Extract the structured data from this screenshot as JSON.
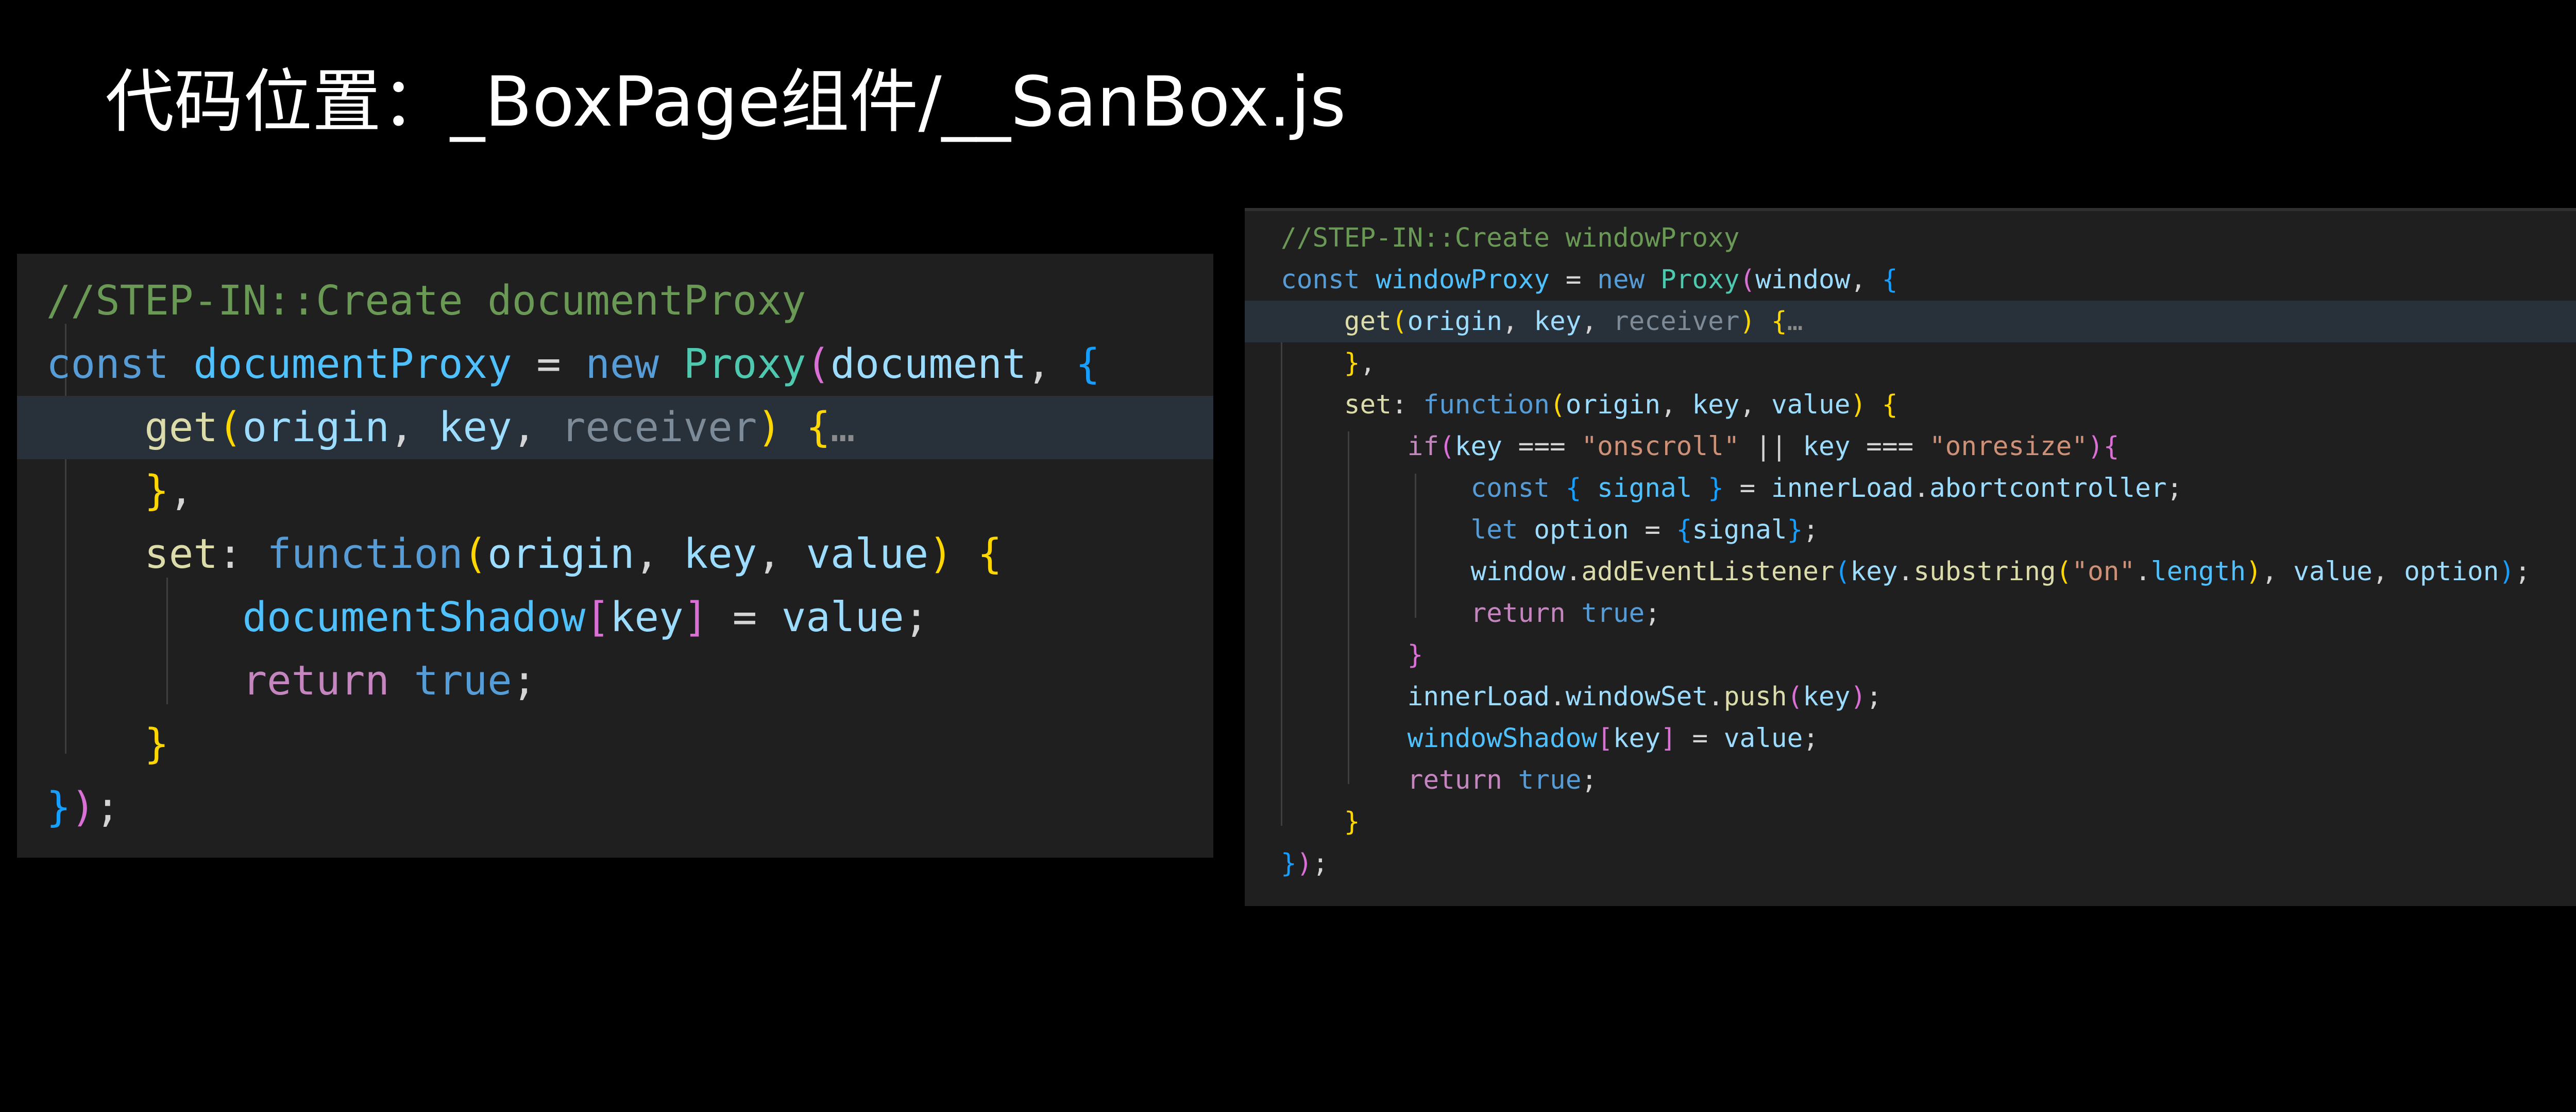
{
  "slide": {
    "title": "代码位置：_BoxPage组件/__SanBox.js"
  },
  "colors": {
    "background": "#000000",
    "editor_bg": "#1f1f1f",
    "highlight_line": "#283039",
    "comment": "#6a9955",
    "keyword": "#569cd6",
    "control": "#c586c0",
    "variable": "#9cdcfe",
    "class": "#4ec9b0",
    "function": "#dcdcaa",
    "string": "#ce9178",
    "bracket_gold": "#ffd700",
    "bracket_pink": "#da70d6",
    "bracket_blue": "#179fff"
  },
  "document_proxy_code": {
    "lines": [
      [
        {
          "t": "//STEP-IN::Create documentProxy",
          "c": "comment"
        }
      ],
      [
        {
          "t": "const ",
          "c": "kw"
        },
        {
          "t": "documentProxy",
          "c": "const"
        },
        {
          "t": " = ",
          "c": "punc"
        },
        {
          "t": "new ",
          "c": "kw"
        },
        {
          "t": "Proxy",
          "c": "class"
        },
        {
          "t": "(",
          "c": "b2"
        },
        {
          "t": "document",
          "c": "var"
        },
        {
          "t": ", ",
          "c": "punc"
        },
        {
          "t": "{",
          "c": "b3"
        }
      ],
      [
        {
          "t": "    ",
          "c": "punc"
        },
        {
          "t": "get",
          "c": "fn"
        },
        {
          "t": "(",
          "c": "b1"
        },
        {
          "t": "origin",
          "c": "var"
        },
        {
          "t": ", ",
          "c": "punc"
        },
        {
          "t": "key",
          "c": "var"
        },
        {
          "t": ", ",
          "c": "punc"
        },
        {
          "t": "receiver",
          "c": "muted"
        },
        {
          "t": ") ",
          "c": "b1"
        },
        {
          "t": "{",
          "c": "b1"
        },
        {
          "t": "…",
          "c": "fold"
        }
      ],
      [
        {
          "t": "    ",
          "c": "punc"
        },
        {
          "t": "}",
          "c": "b1"
        },
        {
          "t": ",",
          "c": "punc"
        }
      ],
      [
        {
          "t": "    ",
          "c": "punc"
        },
        {
          "t": "set",
          "c": "fn"
        },
        {
          "t": ": ",
          "c": "punc"
        },
        {
          "t": "function",
          "c": "kw"
        },
        {
          "t": "(",
          "c": "b1"
        },
        {
          "t": "origin",
          "c": "var"
        },
        {
          "t": ", ",
          "c": "punc"
        },
        {
          "t": "key",
          "c": "var"
        },
        {
          "t": ", ",
          "c": "punc"
        },
        {
          "t": "value",
          "c": "var"
        },
        {
          "t": ") ",
          "c": "b1"
        },
        {
          "t": "{",
          "c": "b1"
        }
      ],
      [
        {
          "t": "        ",
          "c": "punc"
        },
        {
          "t": "documentShadow",
          "c": "const"
        },
        {
          "t": "[",
          "c": "b2"
        },
        {
          "t": "key",
          "c": "var"
        },
        {
          "t": "]",
          "c": "b2"
        },
        {
          "t": " = ",
          "c": "punc"
        },
        {
          "t": "value",
          "c": "var"
        },
        {
          "t": ";",
          "c": "punc"
        }
      ],
      [
        {
          "t": "        ",
          "c": "punc"
        },
        {
          "t": "return ",
          "c": "ctl"
        },
        {
          "t": "true",
          "c": "kw"
        },
        {
          "t": ";",
          "c": "punc"
        }
      ],
      [
        {
          "t": "    ",
          "c": "punc"
        },
        {
          "t": "}",
          "c": "b1"
        }
      ],
      [
        {
          "t": "}",
          "c": "b3"
        },
        {
          "t": ")",
          "c": "b2"
        },
        {
          "t": ";",
          "c": "punc"
        }
      ]
    ]
  },
  "window_proxy_code": {
    "lines": [
      [
        {
          "t": "//STEP-IN::Create windowProxy",
          "c": "comment"
        }
      ],
      [
        {
          "t": "const ",
          "c": "kw"
        },
        {
          "t": "windowProxy",
          "c": "const"
        },
        {
          "t": " = ",
          "c": "punc"
        },
        {
          "t": "new ",
          "c": "kw"
        },
        {
          "t": "Proxy",
          "c": "class"
        },
        {
          "t": "(",
          "c": "b2"
        },
        {
          "t": "window",
          "c": "var"
        },
        {
          "t": ", ",
          "c": "punc"
        },
        {
          "t": "{",
          "c": "b3"
        }
      ],
      [
        {
          "t": "    ",
          "c": "punc"
        },
        {
          "t": "get",
          "c": "fn"
        },
        {
          "t": "(",
          "c": "b1"
        },
        {
          "t": "origin",
          "c": "var"
        },
        {
          "t": ", ",
          "c": "punc"
        },
        {
          "t": "key",
          "c": "var"
        },
        {
          "t": ", ",
          "c": "punc"
        },
        {
          "t": "receiver",
          "c": "muted"
        },
        {
          "t": ") ",
          "c": "b1"
        },
        {
          "t": "{",
          "c": "b1"
        },
        {
          "t": "…",
          "c": "fold"
        }
      ],
      [
        {
          "t": "    ",
          "c": "punc"
        },
        {
          "t": "}",
          "c": "b1"
        },
        {
          "t": ",",
          "c": "punc"
        }
      ],
      [
        {
          "t": "    ",
          "c": "punc"
        },
        {
          "t": "set",
          "c": "fn"
        },
        {
          "t": ": ",
          "c": "punc"
        },
        {
          "t": "function",
          "c": "kw"
        },
        {
          "t": "(",
          "c": "b1"
        },
        {
          "t": "origin",
          "c": "var"
        },
        {
          "t": ", ",
          "c": "punc"
        },
        {
          "t": "key",
          "c": "var"
        },
        {
          "t": ", ",
          "c": "punc"
        },
        {
          "t": "value",
          "c": "var"
        },
        {
          "t": ") ",
          "c": "b1"
        },
        {
          "t": "{",
          "c": "b1"
        }
      ],
      [
        {
          "t": "        ",
          "c": "punc"
        },
        {
          "t": "if",
          "c": "ctl"
        },
        {
          "t": "(",
          "c": "b2"
        },
        {
          "t": "key",
          "c": "var"
        },
        {
          "t": " === ",
          "c": "punc"
        },
        {
          "t": "\"onscroll\"",
          "c": "str"
        },
        {
          "t": " || ",
          "c": "punc"
        },
        {
          "t": "key",
          "c": "var"
        },
        {
          "t": " === ",
          "c": "punc"
        },
        {
          "t": "\"onresize\"",
          "c": "str"
        },
        {
          "t": ")",
          "c": "b2"
        },
        {
          "t": "{",
          "c": "b2"
        }
      ],
      [
        {
          "t": "            ",
          "c": "punc"
        },
        {
          "t": "const ",
          "c": "kw"
        },
        {
          "t": "{ ",
          "c": "b3"
        },
        {
          "t": "signal",
          "c": "const"
        },
        {
          "t": " }",
          "c": "b3"
        },
        {
          "t": " = ",
          "c": "punc"
        },
        {
          "t": "innerLoad",
          "c": "var"
        },
        {
          "t": ".",
          "c": "punc"
        },
        {
          "t": "abortcontroller",
          "c": "var"
        },
        {
          "t": ";",
          "c": "punc"
        }
      ],
      [
        {
          "t": "            ",
          "c": "punc"
        },
        {
          "t": "let ",
          "c": "kw"
        },
        {
          "t": "option",
          "c": "var"
        },
        {
          "t": " = ",
          "c": "punc"
        },
        {
          "t": "{",
          "c": "b3"
        },
        {
          "t": "signal",
          "c": "var"
        },
        {
          "t": "}",
          "c": "b3"
        },
        {
          "t": ";",
          "c": "punc"
        }
      ],
      [
        {
          "t": "            ",
          "c": "punc"
        },
        {
          "t": "window",
          "c": "var"
        },
        {
          "t": ".",
          "c": "punc"
        },
        {
          "t": "addEventListener",
          "c": "fn"
        },
        {
          "t": "(",
          "c": "b3"
        },
        {
          "t": "key",
          "c": "var"
        },
        {
          "t": ".",
          "c": "punc"
        },
        {
          "t": "substring",
          "c": "fn"
        },
        {
          "t": "(",
          "c": "b1"
        },
        {
          "t": "\"on\"",
          "c": "str"
        },
        {
          "t": ".",
          "c": "punc"
        },
        {
          "t": "length",
          "c": "const"
        },
        {
          "t": ")",
          "c": "b1"
        },
        {
          "t": ", ",
          "c": "punc"
        },
        {
          "t": "value",
          "c": "var"
        },
        {
          "t": ", ",
          "c": "punc"
        },
        {
          "t": "option",
          "c": "var"
        },
        {
          "t": ")",
          "c": "b3"
        },
        {
          "t": ";",
          "c": "punc"
        }
      ],
      [
        {
          "t": "            ",
          "c": "punc"
        },
        {
          "t": "return ",
          "c": "ctl"
        },
        {
          "t": "true",
          "c": "kw"
        },
        {
          "t": ";",
          "c": "punc"
        }
      ],
      [
        {
          "t": "        ",
          "c": "punc"
        },
        {
          "t": "}",
          "c": "b2"
        }
      ],
      [
        {
          "t": "        ",
          "c": "punc"
        },
        {
          "t": "innerLoad",
          "c": "var"
        },
        {
          "t": ".",
          "c": "punc"
        },
        {
          "t": "windowSet",
          "c": "var"
        },
        {
          "t": ".",
          "c": "punc"
        },
        {
          "t": "push",
          "c": "fn"
        },
        {
          "t": "(",
          "c": "b2"
        },
        {
          "t": "key",
          "c": "var"
        },
        {
          "t": ")",
          "c": "b2"
        },
        {
          "t": ";",
          "c": "punc"
        }
      ],
      [
        {
          "t": "        ",
          "c": "punc"
        },
        {
          "t": "windowShadow",
          "c": "const"
        },
        {
          "t": "[",
          "c": "b2"
        },
        {
          "t": "key",
          "c": "var"
        },
        {
          "t": "]",
          "c": "b2"
        },
        {
          "t": " = ",
          "c": "punc"
        },
        {
          "t": "value",
          "c": "var"
        },
        {
          "t": ";",
          "c": "punc"
        }
      ],
      [
        {
          "t": "        ",
          "c": "punc"
        },
        {
          "t": "return ",
          "c": "ctl"
        },
        {
          "t": "true",
          "c": "kw"
        },
        {
          "t": ";",
          "c": "punc"
        }
      ],
      [
        {
          "t": "    ",
          "c": "punc"
        },
        {
          "t": "}",
          "c": "b1"
        }
      ],
      [
        {
          "t": "}",
          "c": "b3"
        },
        {
          "t": ")",
          "c": "b2"
        },
        {
          "t": ";",
          "c": "punc"
        }
      ]
    ]
  }
}
